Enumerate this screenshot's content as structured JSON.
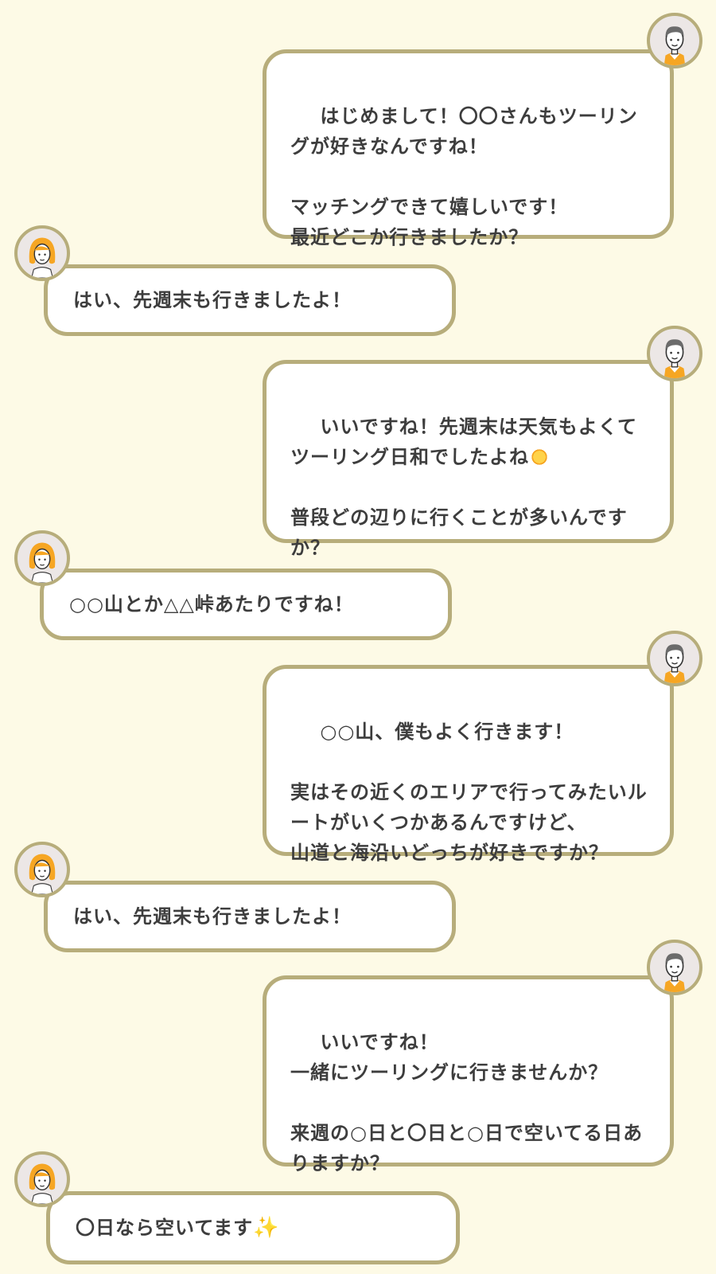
{
  "messages": [
    {
      "side": "right",
      "text": "はじめまして！〇〇さんもツーリングが好きなんですね！\n\nマッチングできて嬉しいです！\n最近どこか行きましたか？"
    },
    {
      "side": "left",
      "text": "はい、先週末も行きましたよ！"
    },
    {
      "side": "right",
      "text": "いいですね！先週末は天気もよくてツーリング日和でしたよね",
      "emoji": "sun-emoji",
      "text2": "\n\n普段どの辺りに行くことが多いんですか？"
    },
    {
      "side": "left",
      "text": "○○山とか△△峠あたりですね！"
    },
    {
      "side": "right",
      "text": "○○山、僕もよく行きます！\n\n実はその近くのエリアで行ってみたいルートがいくつかあるんですけど、\n山道と海沿いどっちが好きですか？"
    },
    {
      "side": "left",
      "text": "はい、先週末も行きましたよ！"
    },
    {
      "side": "right",
      "text": "いいですね！\n一緒にツーリングに行きませんか？\n\n来週の○日と〇日と○日で空いてる日ありますか？"
    },
    {
      "side": "left",
      "text": "〇日なら空いてます",
      "emoji": "sparkles-emoji",
      "emoji_char": "✨"
    }
  ],
  "avatars": {
    "male": "male-avatar-icon",
    "female": "female-avatar-icon"
  },
  "colors": {
    "background": "#fdfae6",
    "bubble_border": "#b7ad7b",
    "bubble_fill": "#ffffff",
    "text": "#3d3d3d",
    "accent_orange": "#f6a623"
  }
}
